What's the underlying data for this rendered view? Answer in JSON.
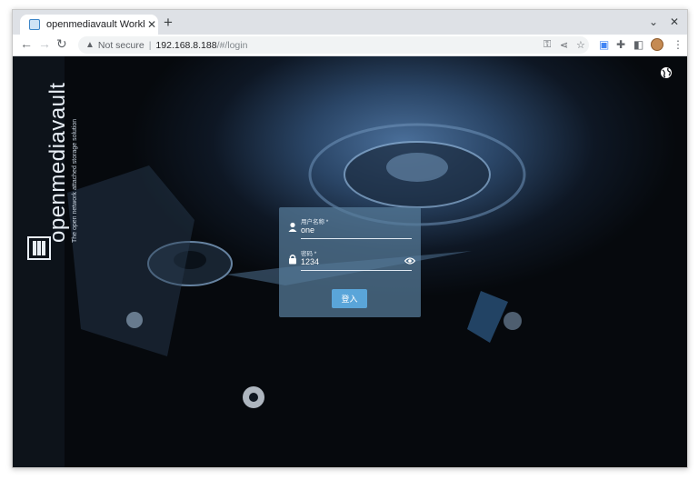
{
  "browser": {
    "tab_title": "openmediavault Workbench",
    "tab_close": "✕",
    "new_tab": "+",
    "security_label": "Not secure",
    "url_host": "192.168.8.188",
    "url_path": "/#/login"
  },
  "sidebar": {
    "brand": "openmediavault",
    "tagline": "The open network attached storage solution"
  },
  "login": {
    "username_label": "用户名称 *",
    "username_value": "one",
    "password_label": "密码 *",
    "password_value": "1234",
    "submit_label": "登入"
  }
}
